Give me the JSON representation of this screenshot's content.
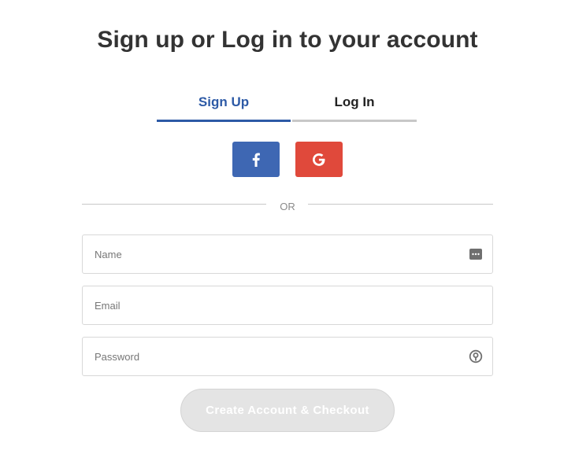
{
  "title": "Sign up or Log in to your account",
  "tabs": {
    "signup": "Sign Up",
    "login": "Log In",
    "active": "signup",
    "active_color": "#2d5aa6"
  },
  "social": {
    "facebook": {
      "icon": "facebook-icon",
      "color": "#3e67b3"
    },
    "google": {
      "icon": "google-icon",
      "color": "#e0493b"
    }
  },
  "divider_text": "OR",
  "form": {
    "name": {
      "placeholder": "Name",
      "value": "",
      "icon": "autofill-contact-icon"
    },
    "email": {
      "placeholder": "Email",
      "value": ""
    },
    "password": {
      "placeholder": "Password",
      "value": "",
      "icon": "password-manager-icon"
    },
    "submit_label": "Create Account & Checkout"
  }
}
